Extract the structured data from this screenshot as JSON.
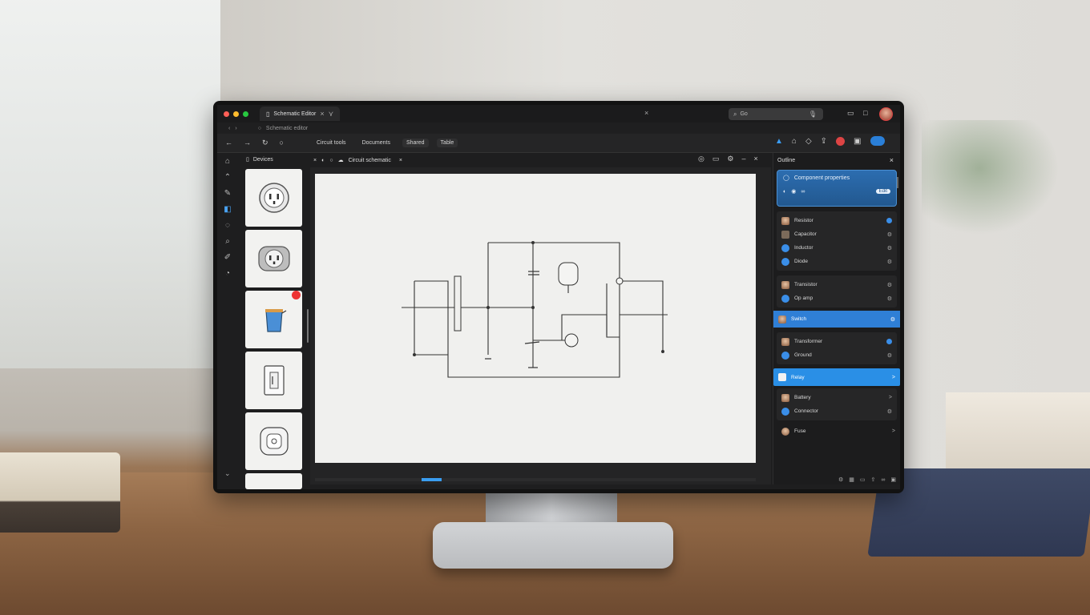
{
  "titlebar": {
    "tab_label": "Schematic Editor",
    "tab_close": "×",
    "tab_extra": "⋎",
    "window_close": "×",
    "search_text": "Go"
  },
  "urlbar": {
    "text": "Schematic editor"
  },
  "toolbar": {
    "menu": [
      "Circuit tools",
      "Documents",
      "Shared",
      "Table"
    ]
  },
  "library": {
    "header": "Devices"
  },
  "canvas": {
    "tab_label": "Circuit schematic",
    "tab_close": "×"
  },
  "panel": {
    "title": "Outline",
    "close": "×",
    "card": {
      "title": "Component properties",
      "pill": "Edit"
    },
    "groups": [
      {
        "rows": [
          {
            "label": "Resistor",
            "icon": "face",
            "trail": "dot"
          },
          {
            "label": "Capacitor",
            "icon": "square",
            "trail": "gear"
          },
          {
            "label": "Inductor",
            "icon": "round",
            "trail": "gear"
          },
          {
            "label": "Diode",
            "icon": "round",
            "trail": "gear"
          }
        ]
      },
      {
        "rows": [
          {
            "label": "Transistor",
            "icon": "face",
            "trail": "gear"
          },
          {
            "label": "Op amp",
            "icon": "round",
            "trail": "gear"
          }
        ]
      }
    ],
    "selected_row": {
      "label": "Switch",
      "trail": "gear"
    },
    "group3": [
      {
        "label": "Transformer",
        "icon": "face",
        "trail": "dot"
      },
      {
        "label": "Ground",
        "icon": "round",
        "trail": "gear"
      }
    ],
    "selected_row_2": {
      "label": "Relay",
      "trail": ">"
    },
    "group4": [
      {
        "label": "Battery",
        "icon": "face",
        "trail": ">"
      },
      {
        "label": "Connector",
        "icon": "round",
        "trail": "gear"
      }
    ],
    "last_row": {
      "label": "Fuse",
      "trail": ">"
    }
  },
  "colors": {
    "accent": "#2f7fd6",
    "traffic_red": "#ff5f57",
    "traffic_yellow": "#febc2e",
    "traffic_green": "#28c840",
    "badge_red": "#e33333"
  },
  "icons": {
    "rail": [
      "home-icon",
      "arrow-icon",
      "pen-icon",
      "layers-icon",
      "chat-icon",
      "search-icon",
      "brush-icon",
      "clock-icon"
    ],
    "library_items": [
      "outlet-icon",
      "plug-icon",
      "cup-icon",
      "switch-icon",
      "socket-icon"
    ]
  }
}
